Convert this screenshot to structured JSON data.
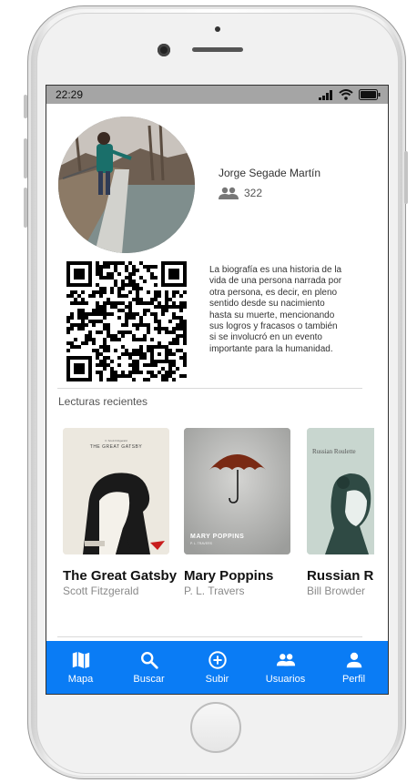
{
  "status_bar": {
    "time": "22:29"
  },
  "profile": {
    "name": "Jorge Segade Martín",
    "followers": "322",
    "bio": "La biografía es una historia de la vida de una persona narrada por otra persona, es decir, en pleno sentido desde su nacimiento hasta su muerte, mencionando sus logros y fracasos o también si se involucró en un evento importante para la humanidad."
  },
  "recent_reads": {
    "title": "Lecturas recientes",
    "books": [
      {
        "title": "The Great Gatsby",
        "author": "Scott Fitzgerald",
        "cover_text": "THE GREAT GATSBY",
        "cover_subtitle": "F. Scott Fitzgerald"
      },
      {
        "title": "Mary Poppins",
        "author": "P. L. Travers",
        "cover_text": "MARY POPPINS",
        "cover_subtitle": "P. L. TRAVERS"
      },
      {
        "title": "Russian Roulette",
        "author": "Bill Browder",
        "cover_text": "Russian Roulette"
      }
    ]
  },
  "tabbar": {
    "tabs": [
      {
        "label": "Mapa",
        "icon": "map-icon"
      },
      {
        "label": "Buscar",
        "icon": "search-icon"
      },
      {
        "label": "Subir",
        "icon": "upload-icon"
      },
      {
        "label": "Usuarios",
        "icon": "users-icon"
      },
      {
        "label": "Perfil",
        "icon": "person-icon"
      }
    ]
  },
  "colors": {
    "tabbar": "#0a7cf5",
    "status_bar": "#a5a5a5"
  }
}
